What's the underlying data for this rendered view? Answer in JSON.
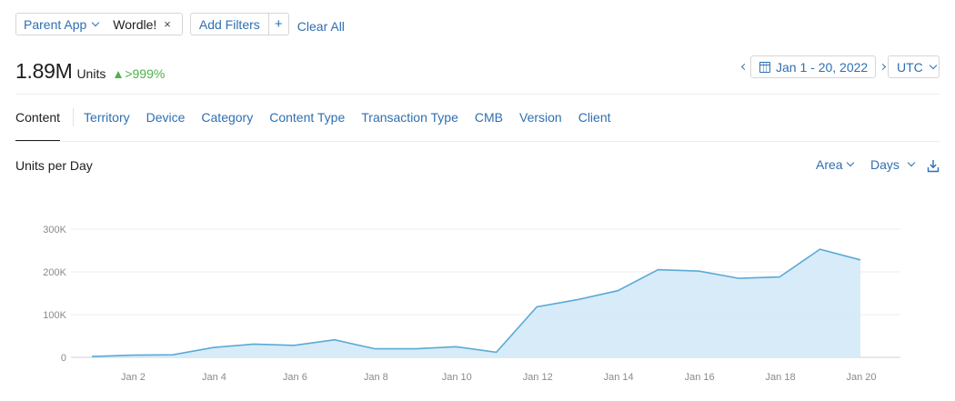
{
  "filters": {
    "chip_key": "Parent App",
    "chip_value": "Wordle!",
    "chip_remove": "×",
    "add_filters": "Add Filters",
    "add_plus": "+",
    "clear_all": "Clear All"
  },
  "summary": {
    "total": "1.89M",
    "units": "Units",
    "change": ">999%"
  },
  "date_range": {
    "label": "Jan 1 - 20, 2022",
    "timezone": "UTC"
  },
  "tabs": [
    {
      "label": "Content",
      "active": true
    },
    {
      "label": "Territory"
    },
    {
      "label": "Device"
    },
    {
      "label": "Category"
    },
    {
      "label": "Content Type"
    },
    {
      "label": "Transaction Type"
    },
    {
      "label": "CMB"
    },
    {
      "label": "Version"
    },
    {
      "label": "Client"
    }
  ],
  "chart_header": {
    "title": "Units per Day",
    "type_select": "Area",
    "interval_select": "Days"
  },
  "colors": {
    "accent": "#2f6fb0",
    "line": "#5aaad6",
    "fill": "#d6eaf8",
    "positive": "#4cb04c"
  },
  "icons": {
    "calendar": "calendar-icon",
    "download": "download-icon"
  },
  "chart_data": {
    "type": "area",
    "x": [
      "Jan 1",
      "Jan 2",
      "Jan 3",
      "Jan 4",
      "Jan 5",
      "Jan 6",
      "Jan 7",
      "Jan 8",
      "Jan 9",
      "Jan 10",
      "Jan 11",
      "Jan 12",
      "Jan 13",
      "Jan 14",
      "Jan 15",
      "Jan 16",
      "Jan 17",
      "Jan 18",
      "Jan 19",
      "Jan 20"
    ],
    "values": [
      2000,
      5000,
      6000,
      23000,
      31000,
      28000,
      41000,
      20000,
      20000,
      25000,
      12000,
      118000,
      135000,
      156000,
      205000,
      202000,
      185000,
      188000,
      253000,
      228000
    ],
    "x_tick_labels": [
      "Jan 2",
      "Jan 4",
      "Jan 6",
      "Jan 8",
      "Jan 10",
      "Jan 12",
      "Jan 14",
      "Jan 16",
      "Jan 18",
      "Jan 20"
    ],
    "y_ticks": [
      {
        "value": 0,
        "label": "0"
      },
      {
        "value": 100000,
        "label": "100K"
      },
      {
        "value": 200000,
        "label": "200K"
      },
      {
        "value": 300000,
        "label": "300K"
      }
    ],
    "ylim": [
      0,
      300000
    ],
    "grid": true,
    "title": "Units per Day",
    "xlabel": "",
    "ylabel": ""
  }
}
